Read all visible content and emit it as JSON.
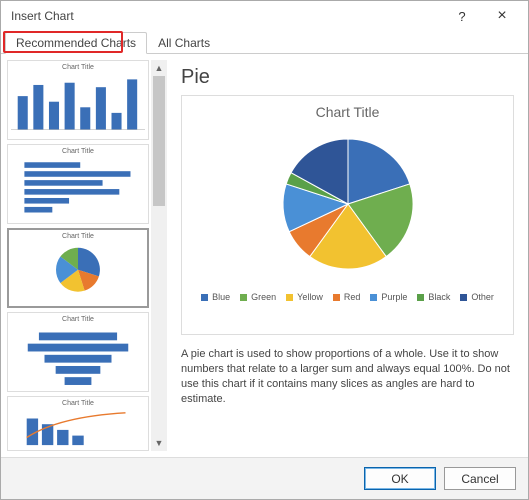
{
  "dialog": {
    "title": "Insert Chart",
    "help_tooltip": "?",
    "close_tooltip": "×"
  },
  "tabs": {
    "recommended": "Recommended Charts",
    "all": "All Charts"
  },
  "preview": {
    "heading": "Pie",
    "chart_title": "Chart Title",
    "description": "A pie chart is used to show proportions of a whole. Use it to show numbers that relate to a larger sum and always equal 100%. Do not use this chart if it contains many slices as angles are hard to estimate."
  },
  "legend": {
    "items": [
      {
        "label": "Blue",
        "color": "#3a6fb7"
      },
      {
        "label": "Green",
        "color": "#6fae4f"
      },
      {
        "label": "Yellow",
        "color": "#f2c230"
      },
      {
        "label": "Red",
        "color": "#e87a2e"
      },
      {
        "label": "Purple",
        "color": "#4a90d6"
      },
      {
        "label": "Black",
        "color": "#5aa049"
      },
      {
        "label": "Other",
        "color": "#2f5597"
      }
    ]
  },
  "thumbnails": {
    "title_text": "Chart Title"
  },
  "buttons": {
    "ok": "OK",
    "cancel": "Cancel"
  },
  "chart_data": {
    "type": "pie",
    "title": "Chart Title",
    "categories": [
      "Blue",
      "Green",
      "Yellow",
      "Red",
      "Purple",
      "Black",
      "Other"
    ],
    "values": [
      20,
      20,
      20,
      8,
      12,
      3,
      17
    ],
    "colors": [
      "#3a6fb7",
      "#6fae4f",
      "#f2c230",
      "#e87a2e",
      "#4a90d6",
      "#5aa049",
      "#2f5597"
    ]
  }
}
